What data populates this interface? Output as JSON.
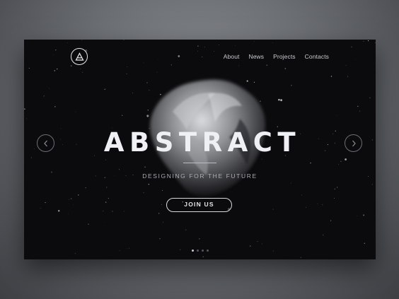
{
  "header": {
    "logo_icon": "triangle-a-logo-icon",
    "nav": [
      {
        "label": "About"
      },
      {
        "label": "News"
      },
      {
        "label": "Projects"
      },
      {
        "label": "Contacts"
      }
    ]
  },
  "hero": {
    "title": "ABSTRACT",
    "subtitle": "DESIGNING FOR THE FUTURE",
    "cta_label": "JOIN US"
  },
  "slider": {
    "prev_icon": "chevron-left-icon",
    "next_icon": "chevron-right-icon",
    "total_slides": 4,
    "active_slide": 1
  },
  "colors": {
    "page_background": "#6c6f74",
    "card_background": "#0b0b0d",
    "text_primary": "#eef0f4",
    "text_secondary": "#a9acb2"
  }
}
